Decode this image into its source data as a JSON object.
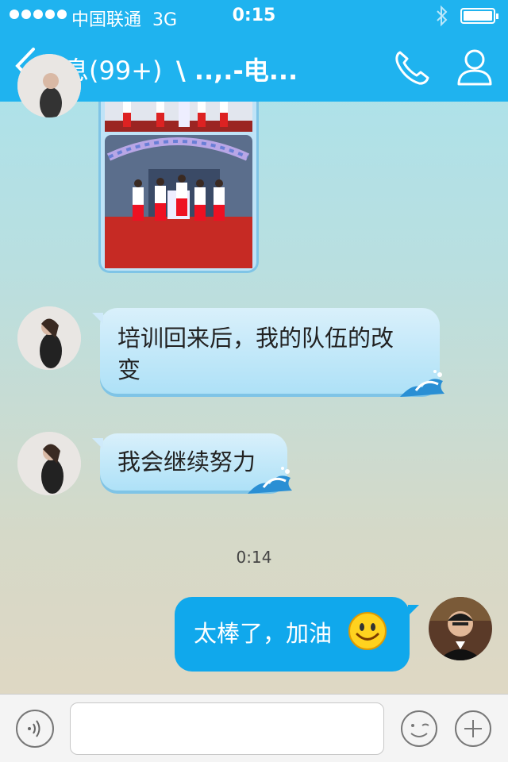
{
  "status_bar": {
    "carrier": "中国联通",
    "network": "3G",
    "time": "0:15"
  },
  "nav": {
    "back_label": "消息(99+)",
    "title": "\\  ..,.-电...",
    "icons": [
      "chevron-left-icon",
      "phone-icon",
      "person-icon"
    ]
  },
  "messages": [
    {
      "side": "left",
      "type": "image",
      "description_hidden": true
    },
    {
      "side": "left",
      "type": "text",
      "line1": "培训回来后，我的队伍的改",
      "line2": "变"
    },
    {
      "side": "left",
      "type": "text",
      "text": "我会继续努力"
    },
    {
      "side": "center",
      "type": "timestamp",
      "text": "0:14"
    },
    {
      "side": "right",
      "type": "text",
      "text": "太棒了，加油",
      "emoji": "smiley-icon"
    }
  ],
  "input_bar": {
    "placeholder": "",
    "icons": [
      "voice-icon",
      "emoji-icon",
      "plus-icon"
    ]
  },
  "colors": {
    "accent": "#1fb3ef",
    "bubble_self": "#10a8ec",
    "bubble_other": "#bfe6f8"
  }
}
